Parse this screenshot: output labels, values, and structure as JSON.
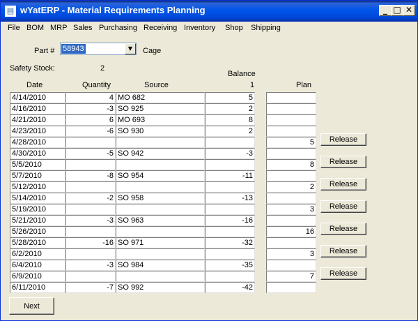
{
  "window": {
    "title": "wYatERP - Material Requirements Planning",
    "app_icon": "app-window-icon"
  },
  "title_buttons": {
    "minimize": "_",
    "maximize": "□",
    "close": "✕"
  },
  "menu": [
    "File",
    "BOM",
    "MRP",
    "Sales",
    "Purchasing",
    "Receiving",
    "Inventory",
    "Shop",
    "Shipping"
  ],
  "part": {
    "label": "Part #",
    "value": "58943",
    "extra": "Cage"
  },
  "safety_stock": {
    "label": "Safety Stock:",
    "value": "2"
  },
  "headers": {
    "date": "Date",
    "quantity": "Quantity",
    "source": "Source",
    "balance_top": "Balance",
    "balance_bottom": "1",
    "plan": "Plan"
  },
  "rows": [
    {
      "date": "4/14/2010",
      "quantity": "4",
      "source": "MO 682",
      "balance": "5",
      "plan": "",
      "release": ""
    },
    {
      "date": "4/16/2010",
      "quantity": "-3",
      "source": "SO 925",
      "balance": "2",
      "plan": "",
      "release": ""
    },
    {
      "date": "4/21/2010",
      "quantity": "6",
      "source": "MO 693",
      "balance": "8",
      "plan": "",
      "release": ""
    },
    {
      "date": "4/23/2010",
      "quantity": "-6",
      "source": "SO 930",
      "balance": "2",
      "plan": "",
      "release": ""
    },
    {
      "date": "4/28/2010",
      "quantity": "",
      "source": "",
      "balance": "",
      "plan": "5",
      "release": "Release"
    },
    {
      "date": "4/30/2010",
      "quantity": "-5",
      "source": "SO 942",
      "balance": "-3",
      "plan": "",
      "release": ""
    },
    {
      "date": "5/5/2010",
      "quantity": "",
      "source": "",
      "balance": "",
      "plan": "8",
      "release": "Release"
    },
    {
      "date": "5/7/2010",
      "quantity": "-8",
      "source": "SO 954",
      "balance": "-11",
      "plan": "",
      "release": ""
    },
    {
      "date": "5/12/2010",
      "quantity": "",
      "source": "",
      "balance": "",
      "plan": "2",
      "release": "Release"
    },
    {
      "date": "5/14/2010",
      "quantity": "-2",
      "source": "SO 958",
      "balance": "-13",
      "plan": "",
      "release": ""
    },
    {
      "date": "5/19/2010",
      "quantity": "",
      "source": "",
      "balance": "",
      "plan": "3",
      "release": "Release"
    },
    {
      "date": "5/21/2010",
      "quantity": "-3",
      "source": "SO 963",
      "balance": "-16",
      "plan": "",
      "release": ""
    },
    {
      "date": "5/26/2010",
      "quantity": "",
      "source": "",
      "balance": "",
      "plan": "16",
      "release": "Release"
    },
    {
      "date": "5/28/2010",
      "quantity": "-16",
      "source": "SO 971",
      "balance": "-32",
      "plan": "",
      "release": ""
    },
    {
      "date": "6/2/2010",
      "quantity": "",
      "source": "",
      "balance": "",
      "plan": "3",
      "release": "Release"
    },
    {
      "date": "6/4/2010",
      "quantity": "-3",
      "source": "SO 984",
      "balance": "-35",
      "plan": "",
      "release": ""
    },
    {
      "date": "6/9/2010",
      "quantity": "",
      "source": "",
      "balance": "",
      "plan": "7",
      "release": "Release"
    },
    {
      "date": "6/11/2010",
      "quantity": "-7",
      "source": "SO 992",
      "balance": "-42",
      "plan": "",
      "release": ""
    }
  ],
  "next_label": "Next"
}
